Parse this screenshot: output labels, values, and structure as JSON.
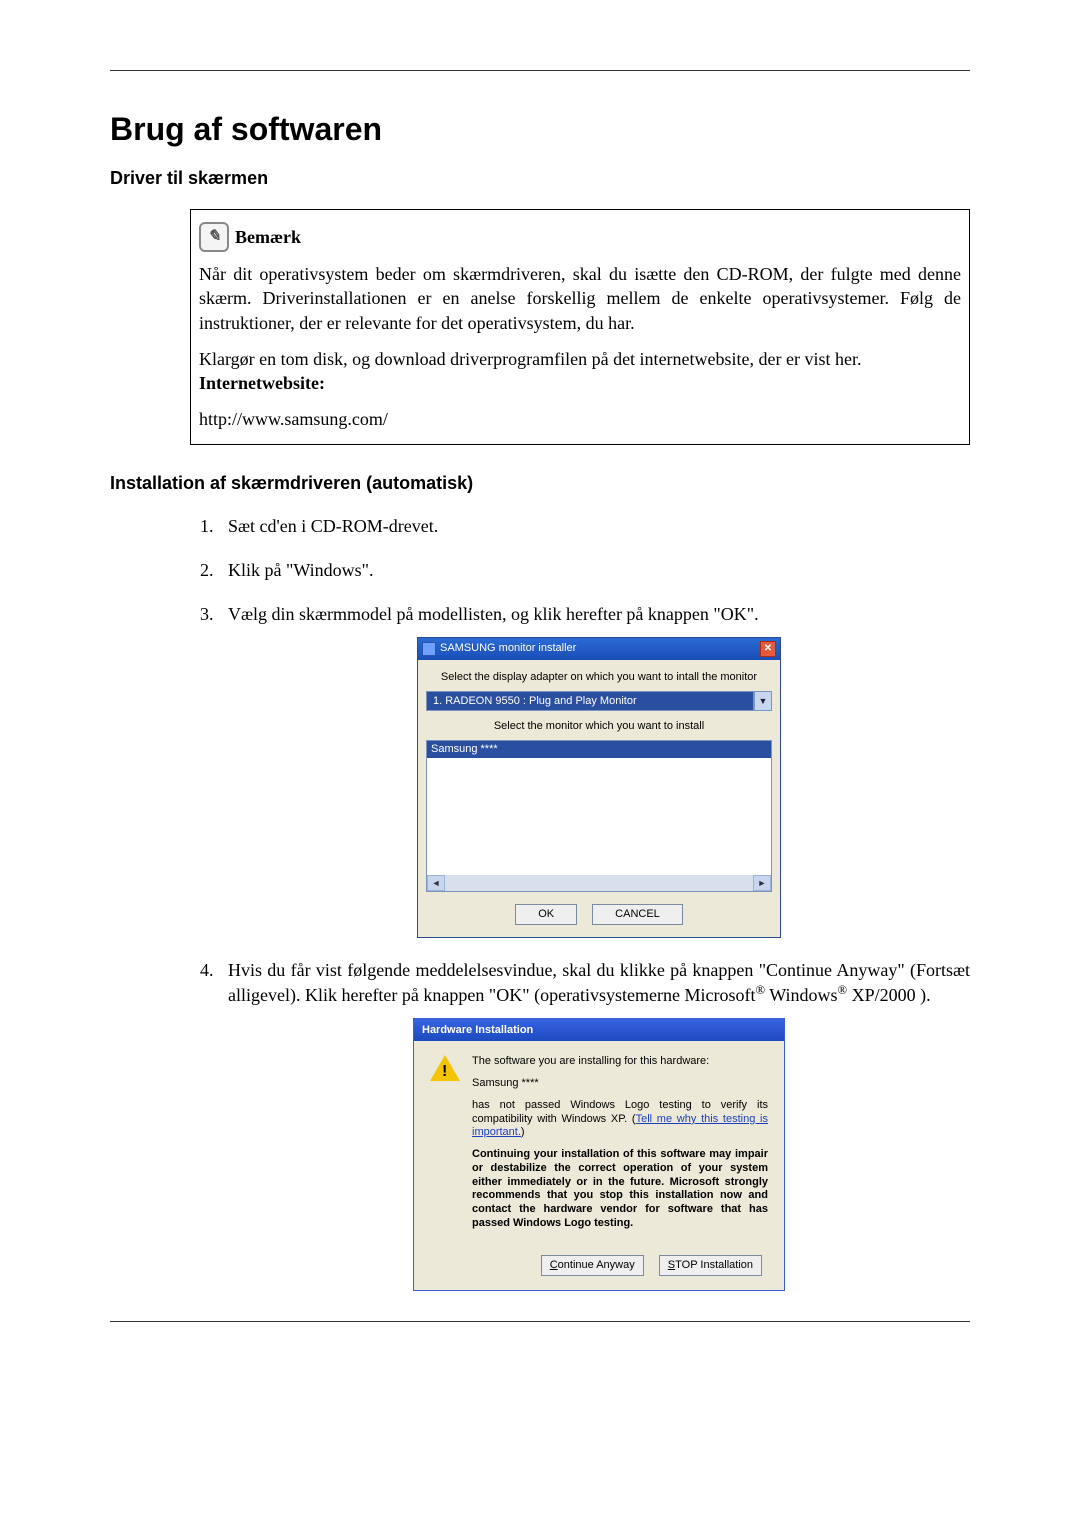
{
  "main_title": "Brug af softwaren",
  "section1_title": "Driver til skærmen",
  "note": {
    "heading": "Bemærk",
    "p1": "Når dit operativsystem beder om skærmdriveren, skal du isætte den CD-ROM, der fulgte med denne skærm. Driverinstallationen er en anelse forskellig mellem de enkelte operativsystemer. Følg de instruktioner, der er relevante for det operativsystem, du har.",
    "p2": "Klargør en tom disk, og download driverprogramfilen på det internetwebsite, der er vist her.",
    "label": "Internetwebsite:",
    "url": "http://www.samsung.com/"
  },
  "section2_title": "Installation af skærmdriveren (automatisk)",
  "steps": {
    "s1": "Sæt cd'en i CD-ROM-drevet.",
    "s2": "Klik på \"Windows\".",
    "s3": "Vælg din skærmmodel på modellisten, og klik herefter på knappen \"OK\".",
    "s4a": "Hvis du får vist følgende meddelelsesvindue, skal du klikke på knappen \"Continue Anyway\" (Fortsæt alligevel). Klik herefter på knappen \"OK\" (operativsystemerne Microsoft",
    "s4b": " Windows",
    "s4c": " XP/2000 )."
  },
  "installer": {
    "title": "SAMSUNG monitor installer",
    "line1": "Select the display adapter on which you want to intall the monitor",
    "dropdown": "1. RADEON 9550 : Plug and Play Monitor",
    "line2": "Select the monitor which you want to install",
    "listitem": "Samsung ****",
    "ok": "OK",
    "cancel": "CANCEL"
  },
  "hw": {
    "title": "Hardware Installation",
    "p1": "The software you are installing for this hardware:",
    "p2": "Samsung ****",
    "p3a": "has not passed Windows Logo testing to verify its compatibility with Windows XP. (",
    "link": "Tell me why this testing is important.",
    "p3b": ")",
    "p4": "Continuing your installation of this software may impair or destabilize the correct operation of your system either immediately or in the future. Microsoft strongly recommends that you stop this installation now and contact the hardware vendor for software that has passed Windows Logo testing.",
    "btn_continue": "Continue Anyway",
    "btn_stop": "STOP Installation"
  }
}
